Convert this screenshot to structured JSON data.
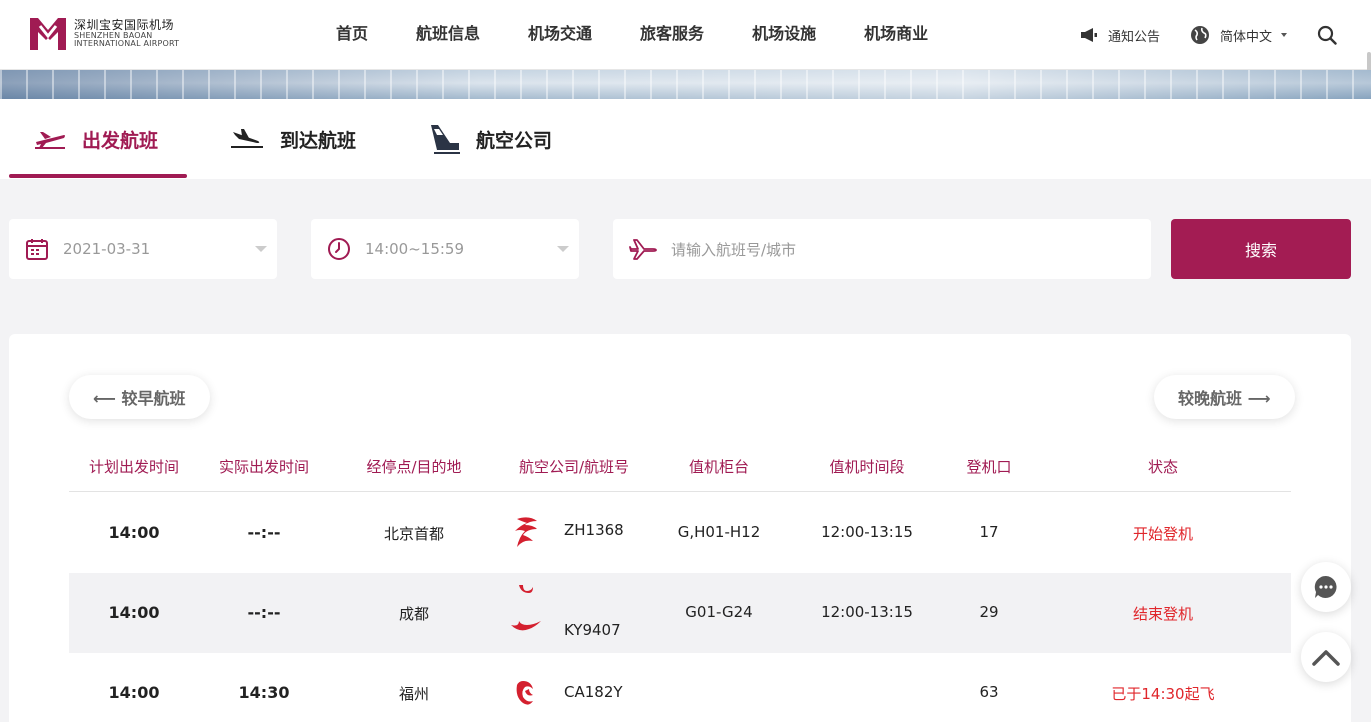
{
  "header": {
    "logo_cn": "深圳宝安国际机场",
    "logo_en_1": "SHENZHEN BAOAN",
    "logo_en_2": "INTERNATIONAL AIRPORT",
    "nav": [
      "首页",
      "航班信息",
      "机场交通",
      "旅客服务",
      "机场设施",
      "机场商业"
    ],
    "notice": "通知公告",
    "language": "简体中文"
  },
  "tabs": [
    {
      "label": "出发航班",
      "icon": "departure-plane-icon",
      "active": true
    },
    {
      "label": "到达航班",
      "icon": "arrival-plane-icon",
      "active": false
    },
    {
      "label": "航空公司",
      "icon": "airline-tail-icon",
      "active": false
    }
  ],
  "search": {
    "date": "2021-03-31",
    "time_range": "14:00~15:59",
    "flight_placeholder": "请输入航班号/城市",
    "button": "搜索"
  },
  "pager": {
    "earlier": "⟵ 较早航班",
    "later": "较晚航班 ⟶"
  },
  "table": {
    "headers": [
      "计划出发时间",
      "实际出发时间",
      "经停点/目的地",
      "航空公司/航班号",
      "值机柜台",
      "值机时间段",
      "登机口",
      "状态"
    ],
    "rows": [
      {
        "scheduled": "14:00",
        "actual": "--:--",
        "dest": "北京首都",
        "flight": "ZH1368",
        "counter": "G,H01-H12",
        "checkin": "12:00-13:15",
        "gate": "17",
        "status": "开始登机"
      },
      {
        "scheduled": "14:00",
        "actual": "--:--",
        "dest": "成都",
        "flight": "KY9407",
        "counter": "G01-G24",
        "checkin": "12:00-13:15",
        "gate": "29",
        "status": "结束登机"
      },
      {
        "scheduled": "14:00",
        "actual": "14:30",
        "dest": "福州",
        "flight": "CA182Y",
        "counter": "",
        "checkin": "",
        "gate": "63",
        "status": "已于14:30起飞"
      }
    ]
  },
  "colors": {
    "brand": "#a01b53",
    "status_red": "#e0262b"
  }
}
